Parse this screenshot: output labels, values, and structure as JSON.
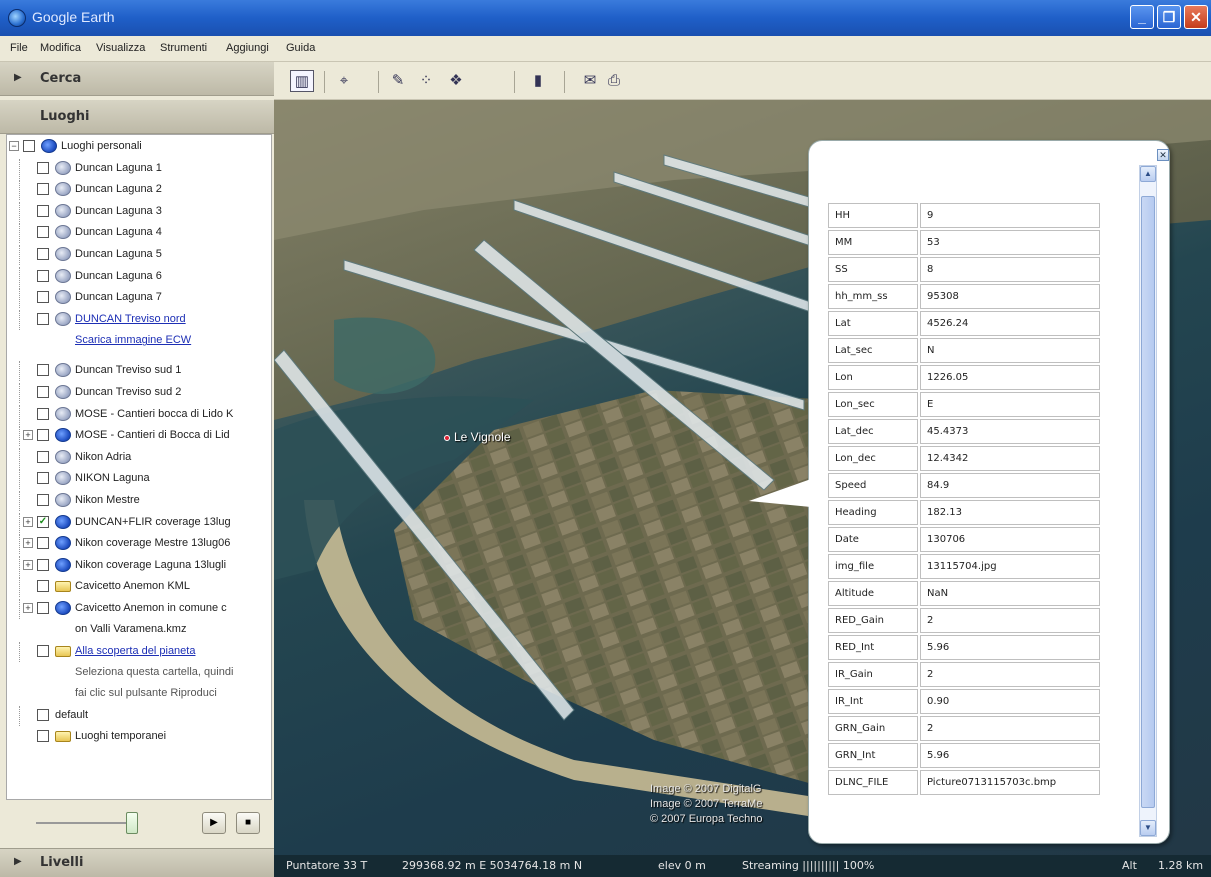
{
  "window": {
    "title": "Google Earth"
  },
  "menu": [
    "File",
    "Modifica",
    "Visualizza",
    "Strumenti",
    "Aggiungi",
    "Guida"
  ],
  "panels": {
    "search": "Cerca",
    "places": "Luoghi",
    "layers": "Livelli"
  },
  "tree": [
    {
      "label": "Luoghi personali",
      "icon": "network-icon",
      "checked": false
    },
    {
      "label": "Duncan Laguna 1",
      "icon": "globe-icon",
      "checked": false
    },
    {
      "label": "Duncan Laguna 2",
      "icon": "globe-icon",
      "checked": false
    },
    {
      "label": "Duncan Laguna 3",
      "icon": "globe-icon",
      "checked": false
    },
    {
      "label": "Duncan Laguna 4",
      "icon": "globe-icon",
      "checked": false
    },
    {
      "label": "Duncan Laguna 5",
      "icon": "globe-icon",
      "checked": false
    },
    {
      "label": "Duncan Laguna 6",
      "icon": "globe-icon",
      "checked": false
    },
    {
      "label": "Duncan Laguna 7",
      "icon": "globe-icon",
      "checked": false
    },
    {
      "label": "DUNCAN Treviso nord",
      "icon": "globe-icon",
      "checked": false,
      "link": true
    },
    {
      "label": "Scarica immagine ECW",
      "link": true,
      "sub": true
    },
    {
      "label": "Duncan Treviso sud 1",
      "icon": "globe-icon",
      "checked": false
    },
    {
      "label": "Duncan Treviso sud 2",
      "icon": "globe-icon",
      "checked": false
    },
    {
      "label": "MOSE - Cantieri bocca di Lido K",
      "icon": "globe-icon",
      "checked": false
    },
    {
      "label": "MOSE - Cantieri di Bocca di Lid",
      "icon": "network-icon",
      "checked": false
    },
    {
      "label": "Nikon Adria",
      "icon": "globe-icon",
      "checked": false
    },
    {
      "label": "NIKON Laguna",
      "icon": "globe-icon",
      "checked": false
    },
    {
      "label": "Nikon Mestre",
      "icon": "globe-icon",
      "checked": false
    },
    {
      "label": "DUNCAN+FLIR coverage 13lug",
      "icon": "network-icon",
      "checked": true
    },
    {
      "label": "Nikon coverage Mestre 13lug06",
      "icon": "network-icon",
      "checked": false
    },
    {
      "label": "Nikon coverage Laguna 13lugli",
      "icon": "network-icon",
      "checked": false
    },
    {
      "label": "Cavicetto Anemon KML",
      "icon": "folder-icon",
      "checked": false
    },
    {
      "label": "Cavicetto Anemon in comune c",
      "icon": "network-icon",
      "checked": false
    },
    {
      "label": "on Valli Varamena.kmz",
      "sub": true
    },
    {
      "label": "Alla scoperta del pianeta",
      "icon": "folder-icon",
      "checked": false,
      "link": true
    },
    {
      "label": "Seleziona questa cartella, quindi",
      "sub": true,
      "gray": true
    },
    {
      "label": "fai clic sul pulsante Riproduci",
      "sub": true,
      "gray": true
    },
    {
      "label": "default",
      "checked": false
    },
    {
      "label": "Luoghi temporanei",
      "icon": "folder-icon",
      "checked": false
    }
  ],
  "map": {
    "placemark": "Le Vignole",
    "copyright": [
      "Image © 2007 DigitalG",
      "Image © 2007 TerraMe",
      "© 2007 Europa Techno"
    ]
  },
  "balloon": {
    "rows": [
      {
        "k": "HH",
        "v": "9"
      },
      {
        "k": "MM",
        "v": "53"
      },
      {
        "k": "SS",
        "v": "8"
      },
      {
        "k": "hh_mm_ss",
        "v": "95308"
      },
      {
        "k": "Lat",
        "v": "4526.24"
      },
      {
        "k": "Lat_sec",
        "v": "N"
      },
      {
        "k": "Lon",
        "v": "1226.05"
      },
      {
        "k": "Lon_sec",
        "v": "E"
      },
      {
        "k": "Lat_dec",
        "v": "45.4373"
      },
      {
        "k": "Lon_dec",
        "v": "12.4342"
      },
      {
        "k": "Speed",
        "v": "84.9"
      },
      {
        "k": "Heading",
        "v": "182.13"
      },
      {
        "k": "Date",
        "v": "130706"
      },
      {
        "k": "img_file",
        "v": "13115704.jpg"
      },
      {
        "k": "Altitude",
        "v": "NaN"
      },
      {
        "k": "RED_Gain",
        "v": "2"
      },
      {
        "k": "RED_Int",
        "v": "5.96"
      },
      {
        "k": "IR_Gain",
        "v": "2"
      },
      {
        "k": "IR_Int",
        "v": "0.90"
      },
      {
        "k": "GRN_Gain",
        "v": "2"
      },
      {
        "k": "GRN_Int",
        "v": "5.96"
      },
      {
        "k": "DLNC_FILE",
        "v": "Picture0713115703c.bmp"
      }
    ]
  },
  "status": {
    "pointer": "Puntatore 33 T",
    "coords": "299368.92 m E  5034764.18 m N",
    "elev": "elev    0 m",
    "streaming": "Streaming |||||||||| 100%",
    "alt": "Alt",
    "eye": "1.28 km"
  }
}
